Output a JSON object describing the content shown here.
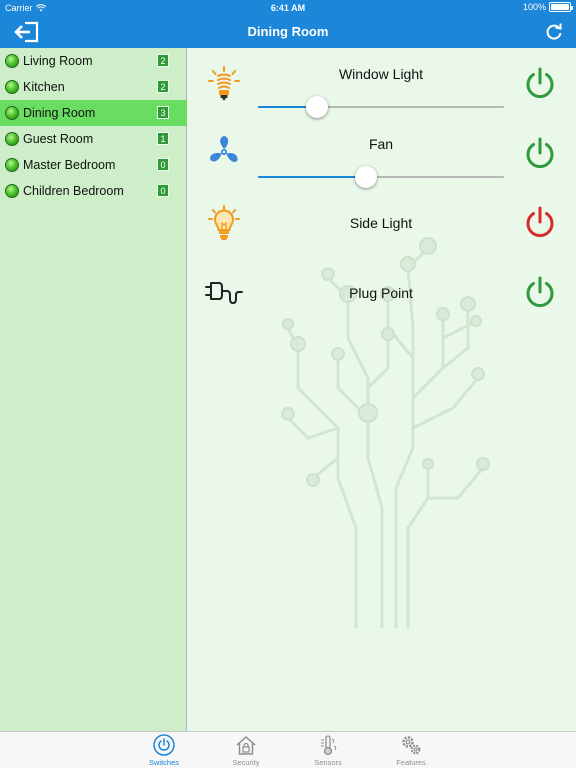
{
  "status_bar": {
    "carrier": "Carrier",
    "time": "6:41 AM",
    "battery": "100%"
  },
  "nav": {
    "title": "Dining Room",
    "left_icon": "logout-icon",
    "right_icon": "refresh-icon"
  },
  "sidebar": {
    "rooms": [
      {
        "name": "Living Room",
        "count": "2",
        "selected": false
      },
      {
        "name": "Kitchen",
        "count": "2",
        "selected": false
      },
      {
        "name": "Dining Room",
        "count": "3",
        "selected": true
      },
      {
        "name": "Guest Room",
        "count": "1",
        "selected": false
      },
      {
        "name": "Master Bedroom",
        "count": "0",
        "selected": false
      },
      {
        "name": "Children Bedroom",
        "count": "0",
        "selected": false
      }
    ]
  },
  "devices": [
    {
      "name": "Window Light",
      "icon": "cfl-bulb-icon",
      "power": "on",
      "dimmer": 0.24
    },
    {
      "name": "Fan",
      "icon": "fan-icon",
      "power": "on",
      "dimmer": 0.44
    },
    {
      "name": "Side Light",
      "icon": "light-bulb-icon",
      "power": "off"
    },
    {
      "name": "Plug Point",
      "icon": "plug-icon",
      "power": "on"
    }
  ],
  "tabs": [
    {
      "label": "Switches",
      "icon": "power-icon",
      "active": true
    },
    {
      "label": "Security",
      "icon": "home-lock-icon",
      "active": false
    },
    {
      "label": "Sensors",
      "icon": "thermometer-icon",
      "active": false
    },
    {
      "label": "Features",
      "icon": "gears-icon",
      "active": false
    }
  ],
  "colors": {
    "accent": "#1c86d8",
    "power_on": "#2e9a3c",
    "power_off": "#d92a2a",
    "selected_room": "#68dd62",
    "sidebar_bg": "#cdeec8"
  }
}
